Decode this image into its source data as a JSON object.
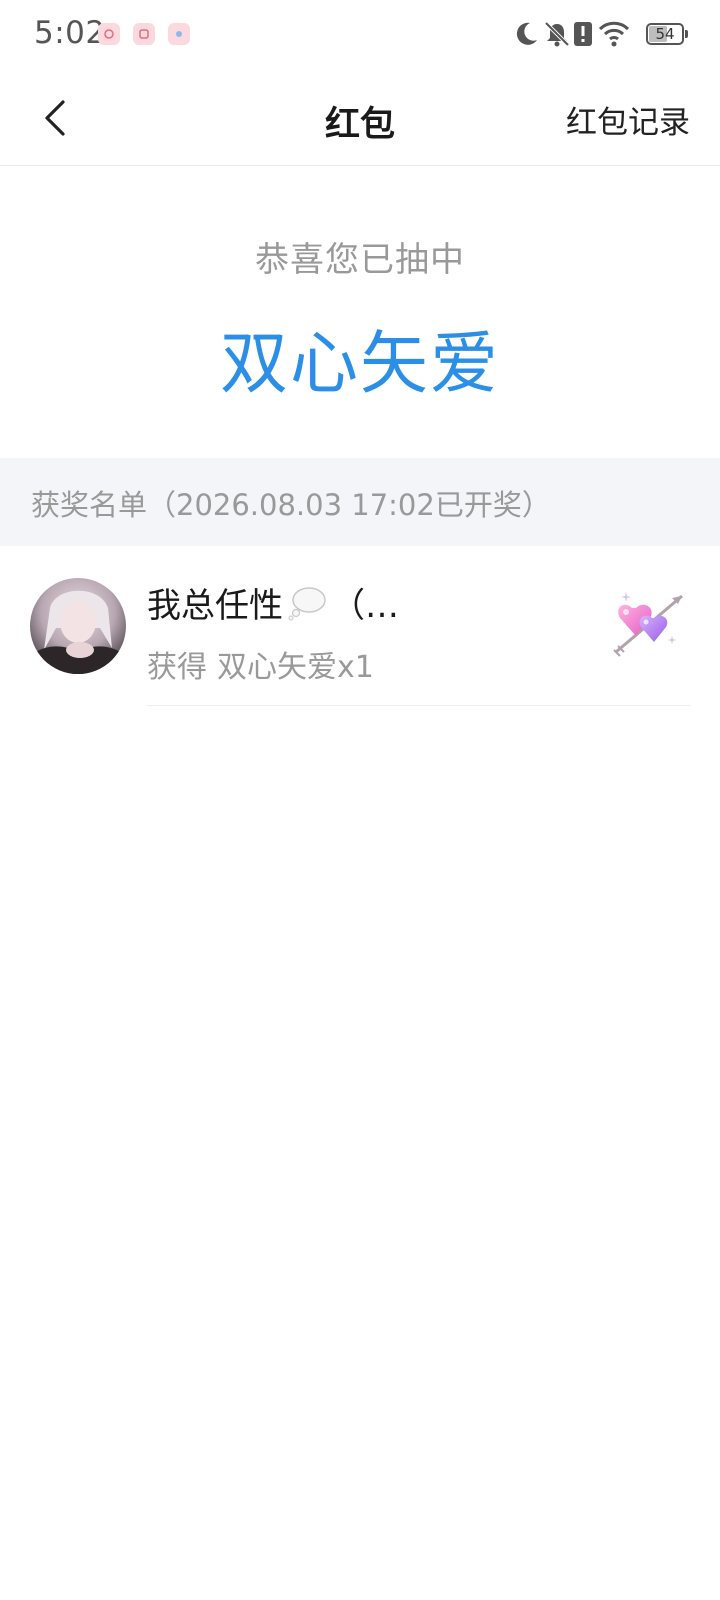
{
  "status_bar": {
    "time": "5:02",
    "battery_level": "54",
    "icons": [
      "notification-app-icon",
      "notification-app-icon",
      "notification-app-icon",
      "moon-icon",
      "bell-off-icon",
      "alert-icon",
      "wifi-icon",
      "battery-icon"
    ]
  },
  "nav": {
    "title": "红包",
    "records_label": "红包记录",
    "back_icon": "chevron-left-icon"
  },
  "result": {
    "congrats_text": "恭喜您已抽中",
    "prize_name": "双心矢爱"
  },
  "winners": {
    "header_text": "获奖名单（2026.08.03 17:02已开奖）",
    "items": [
      {
        "name": "我总任性",
        "name_suffix": "（…",
        "prize_label": "获得",
        "prize_value": "双心矢爱x1"
      }
    ]
  },
  "colors": {
    "accent": "#2b8fe8",
    "muted_text": "#999999",
    "section_bg": "#f4f5f9"
  }
}
